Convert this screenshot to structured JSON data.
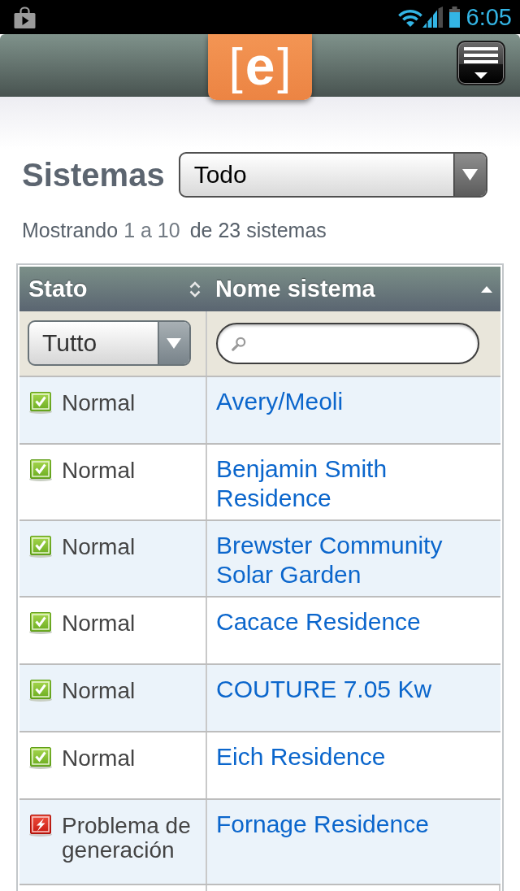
{
  "status_bar": {
    "time": "6:05"
  },
  "header": {
    "logo": "[**e**]"
  },
  "toolbar": {
    "title": "Sistemas",
    "filter": "Todo"
  },
  "summary": {
    "label": "Mostrando",
    "range": "1 a 10",
    "total": "de 23 sistemas"
  },
  "table": {
    "columns": [
      {
        "label": "Stato",
        "sorted": false
      },
      {
        "label": "Nome sistema",
        "sorted": true
      }
    ],
    "status_filter": "Tutto",
    "rows": [
      {
        "kind": "normal",
        "status": "Normal",
        "name": "Avery/Meoli"
      },
      {
        "kind": "normal",
        "status": "Normal",
        "name": "Benjamin Smith Residence"
      },
      {
        "kind": "normal",
        "status": "Normal",
        "name": "Brewster Community Solar Garden"
      },
      {
        "kind": "normal",
        "status": "Normal",
        "name": "Cacace Residence"
      },
      {
        "kind": "normal",
        "status": "Normal",
        "name": "COUTURE 7.05 Kw"
      },
      {
        "kind": "normal",
        "status": "Normal",
        "name": "Eich Residence"
      },
      {
        "kind": "problem",
        "status": "Problema de generación",
        "name": "Fornage Residence"
      }
    ]
  }
}
